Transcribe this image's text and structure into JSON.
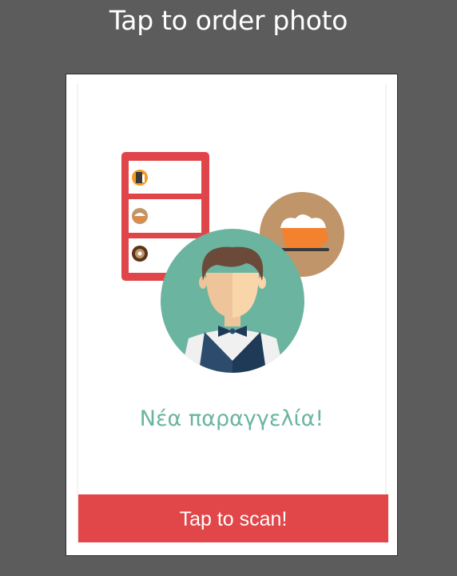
{
  "header": {
    "title": "Tap to order photo"
  },
  "screen": {
    "order_message": "Νέα παραγγελία!",
    "scan_button_label": "Tap to scan!"
  },
  "icons": {
    "menu_board": "menu-board-icon",
    "menu_drink": "drink-icon",
    "menu_dessert": "cake-icon",
    "menu_donut": "donut-icon",
    "coffee": "coffee-cup-icon",
    "waiter": "waiter-avatar"
  },
  "colors": {
    "background": "#5c5c5c",
    "accent_green": "#6bb4a0",
    "accent_red": "#e14649",
    "coffee_circle": "#c09569"
  }
}
